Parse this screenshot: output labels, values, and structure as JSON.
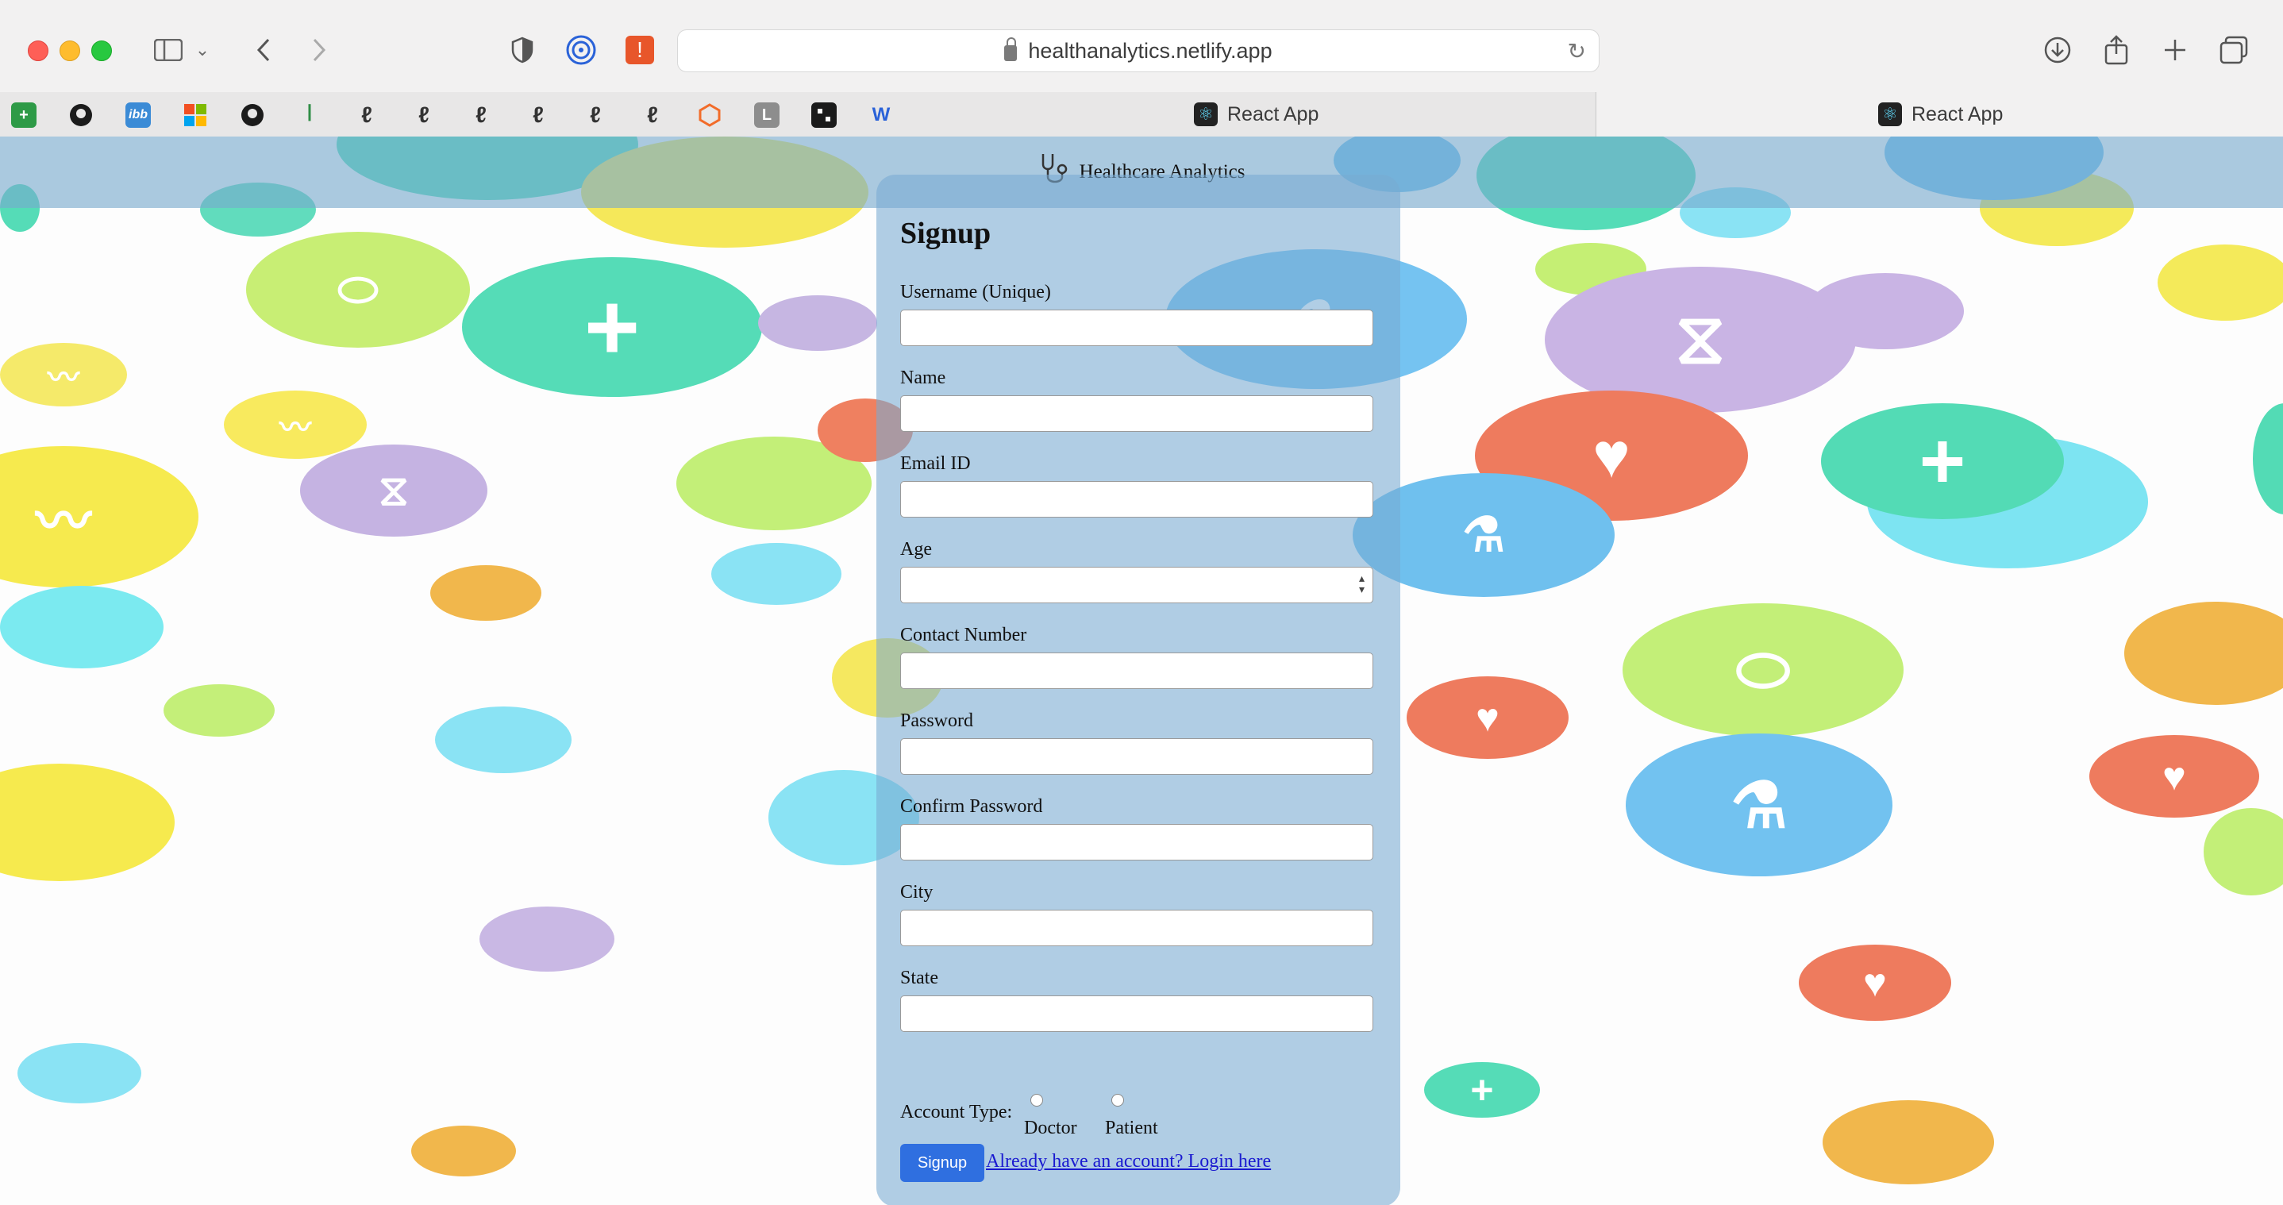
{
  "browser": {
    "url": "healthanalytics.netlify.app",
    "tabs": [
      {
        "label": "React App",
        "active": false
      },
      {
        "label": "React App",
        "active": true
      }
    ],
    "favorites": [
      "plus-sheet",
      "github",
      "ibb",
      "microsoft",
      "github",
      "geeksforgeeks",
      "leetcode",
      "leetcode",
      "leetcode",
      "leetcode",
      "leetcode",
      "leetcode",
      "code-box",
      "L",
      "square-app",
      "wordpress"
    ],
    "fav_text": {
      "ibb": "ibb",
      "L": "L",
      "W": "W"
    }
  },
  "navbar": {
    "title": "Healthcare Analytics",
    "icon": "stethoscope-icon"
  },
  "form": {
    "heading": "Signup",
    "fields": {
      "username": {
        "label": "Username (Unique)",
        "value": ""
      },
      "name": {
        "label": "Name",
        "value": ""
      },
      "email": {
        "label": "Email ID",
        "value": ""
      },
      "age": {
        "label": "Age",
        "value": ""
      },
      "contact": {
        "label": "Contact Number",
        "value": ""
      },
      "password": {
        "label": "Password",
        "value": ""
      },
      "confirm": {
        "label": "Confirm Password",
        "value": ""
      },
      "city": {
        "label": "City",
        "value": ""
      },
      "state": {
        "label": "State",
        "value": ""
      }
    },
    "account_type": {
      "label": "Account Type:",
      "options": [
        "Doctor",
        "Patient"
      ],
      "selected": null
    },
    "submit_label": "Signup",
    "login_link": "Already have an account? Login here"
  },
  "colors": {
    "accent_button": "#2f6fe0",
    "navbar_bg": "#78aacd",
    "panel_bg": "#78aad2"
  }
}
